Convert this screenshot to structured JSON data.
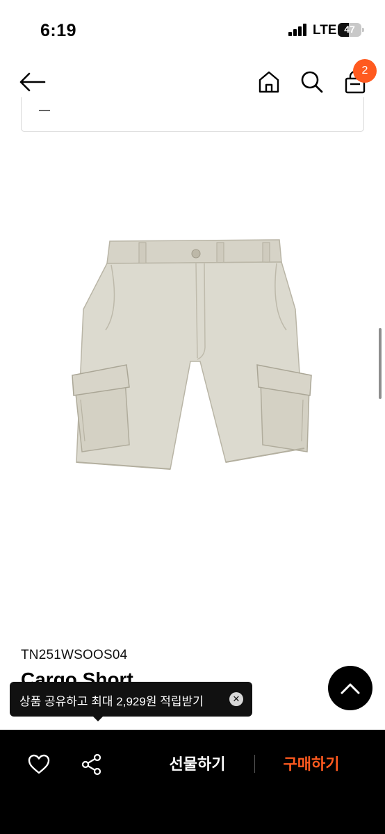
{
  "status_bar": {
    "time": "6:19",
    "network": "LTE",
    "battery_level": "47",
    "battery_fraction": 0.47
  },
  "header": {
    "back_icon": "arrow-left-icon",
    "home_icon": "home-icon",
    "search_icon": "search-icon",
    "cart_icon": "shopping-bag-icon",
    "cart_count": "2"
  },
  "product": {
    "image_icon": "cargo-shorts-image",
    "code": "TN251WSOOS04",
    "name": "Cargo Short"
  },
  "share_tooltip": {
    "text": "상품 공유하고 최대 2,929원 적립받기",
    "close_icon": "close-circle-icon"
  },
  "scroll_top": {
    "icon": "chevron-up-icon"
  },
  "bottom_bar": {
    "like_icon": "heart-icon",
    "share_icon": "share-icon",
    "gift_label": "선물하기",
    "buy_label": "구매하기"
  },
  "colors": {
    "accent": "#ff5a1f",
    "bar_background": "#000000",
    "tooltip_background": "#111111",
    "product_fabric": "#d9d7cc"
  }
}
